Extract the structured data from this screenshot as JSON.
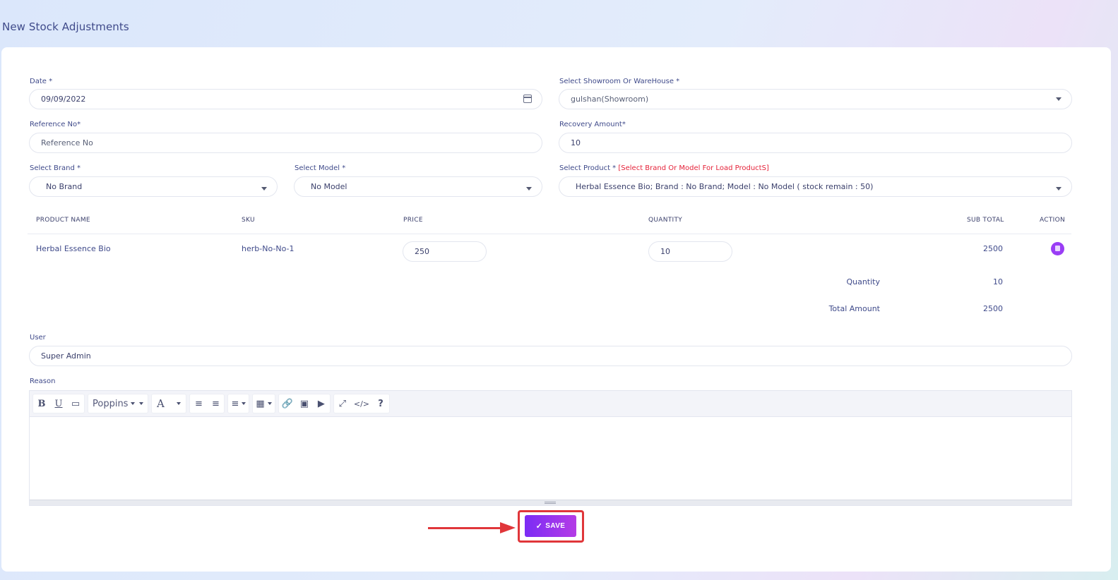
{
  "page": {
    "title": "New Stock Adjustments"
  },
  "form": {
    "date": {
      "label": "Date *",
      "value": "09/09/2022"
    },
    "showroom": {
      "label": "Select Showroom Or WareHouse *",
      "value": "gulshan(Showroom)"
    },
    "reference": {
      "label": "Reference No*",
      "placeholder": "Reference No"
    },
    "recovery": {
      "label": "Recovery Amount*",
      "value": "10"
    },
    "brand": {
      "label": "Select Brand *",
      "value": "No Brand"
    },
    "model": {
      "label": "Select Model *",
      "value": "No Model"
    },
    "product": {
      "label": "Select Product *",
      "hint": "[Select Brand Or Model For Load ProductS]",
      "value": "Herbal Essence Bio; Brand : No Brand; Model : No Model ( stock remain : 50)"
    },
    "user": {
      "label": "User",
      "value": "Super Admin"
    },
    "reason": {
      "label": "Reason"
    }
  },
  "table": {
    "headers": {
      "product_name": "PRODUCT NAME",
      "sku": "SKU",
      "price": "PRICE",
      "quantity": "QUANTITY",
      "sub_total": "SUB TOTAL",
      "action": "ACTION"
    },
    "rows": [
      {
        "product_name": "Herbal Essence Bio",
        "sku": "herb-No-No-1",
        "price": "250",
        "quantity": "10",
        "sub_total": "2500"
      }
    ],
    "summary": {
      "quantity_label": "Quantity",
      "quantity_value": "10",
      "total_label": "Total Amount",
      "total_value": "2500"
    }
  },
  "editor": {
    "font_name": "Poppins"
  },
  "actions": {
    "save_label": "SAVE",
    "save_icon": "✓"
  },
  "colors": {
    "accent": "#8a35f0",
    "annotation": "#e0363a",
    "warning": "#e5233a"
  }
}
